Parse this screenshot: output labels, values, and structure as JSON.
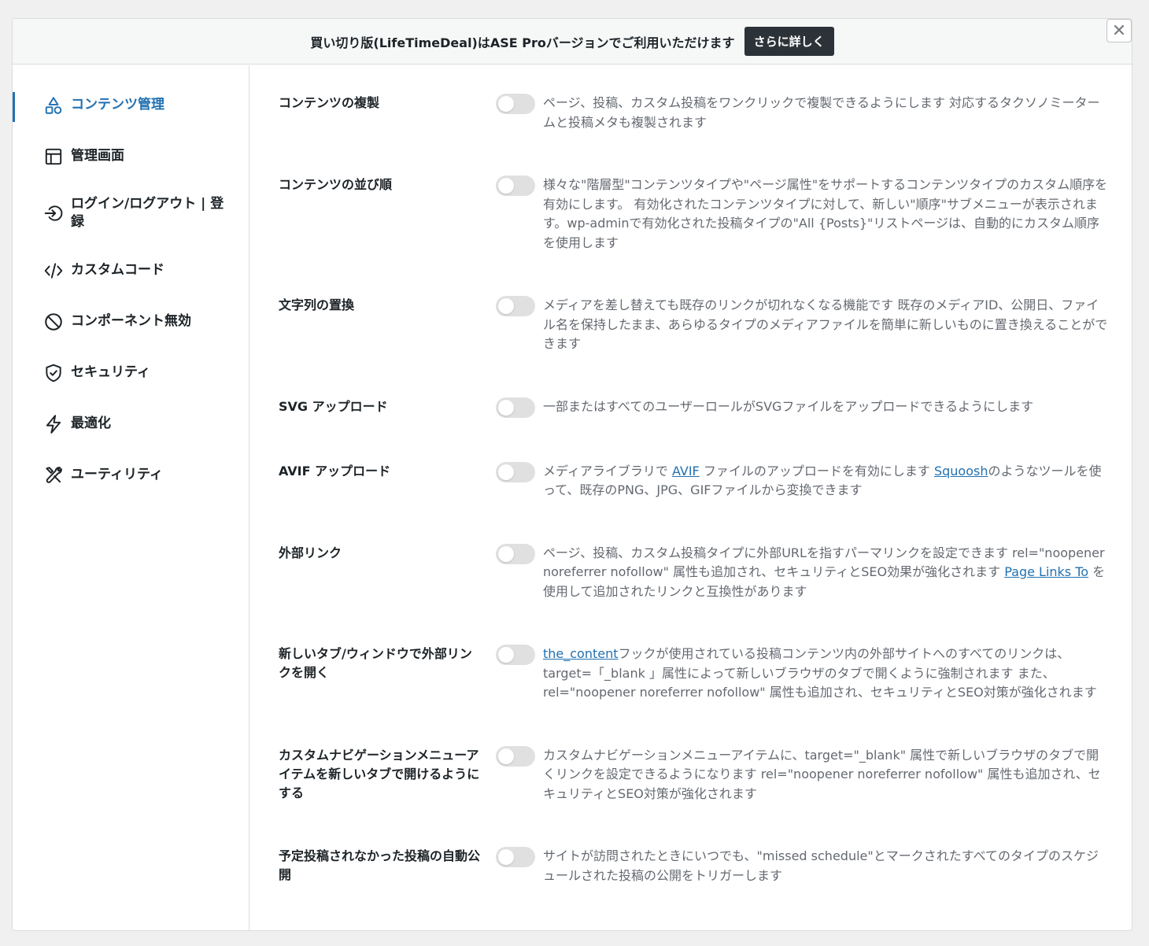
{
  "banner": {
    "text": "買い切り版(LifeTimeDeal)はASE Proバージョンでご利用いただけます",
    "button_label": "さらに詳しく"
  },
  "close_symbol": "✕",
  "colors": {
    "accent": "#2271b1",
    "banner_button": "#2c3338",
    "toggle_off": "#e0e0e0"
  },
  "sidebar": {
    "items": [
      {
        "label": "コンテンツ管理",
        "icon": "shapes-icon",
        "active": true
      },
      {
        "label": "管理画面",
        "icon": "layout-icon"
      },
      {
        "label": "ログイン/ログアウト | 登録",
        "icon": "login-icon"
      },
      {
        "label": "カスタムコード",
        "icon": "code-icon"
      },
      {
        "label": "コンポーネント無効",
        "icon": "ban-icon"
      },
      {
        "label": "セキュリティ",
        "icon": "shield-check-icon"
      },
      {
        "label": "最適化",
        "icon": "lightning-icon"
      },
      {
        "label": "ユーティリティ",
        "icon": "tools-icon"
      }
    ]
  },
  "settings": [
    {
      "title": "コンテンツの複製",
      "enabled": false,
      "desc": [
        "ページ、投稿、カスタム投稿をワンクリックで複製できるようにします 対応するタクソノミータームと投稿メタも複製されます"
      ]
    },
    {
      "title": "コンテンツの並び順",
      "enabled": false,
      "desc": [
        "様々な\"階層型\"コンテンツタイプや\"ページ属性\"をサポートするコンテンツタイプのカスタム順序を有効にします。 有効化されたコンテンツタイプに対して、新しい\"順序\"サブメニューが表示されます。wp-adminで有効化された投稿タイプの\"All {Posts}\"リストページは、自動的にカスタム順序を使用します"
      ]
    },
    {
      "title": "文字列の置換",
      "enabled": false,
      "desc": [
        "メディアを差し替えても既存のリンクが切れなくなる機能です 既存のメディアID、公開日、ファイル名を保持したまま、あらゆるタイプのメディアファイルを簡単に新しいものに置き換えることができます"
      ]
    },
    {
      "title": "SVG アップロード",
      "enabled": false,
      "desc": [
        "一部またはすべてのユーザーロールがSVGファイルをアップロードできるようにします"
      ]
    },
    {
      "title": "AVIF アップロード",
      "enabled": false,
      "desc": [
        "メディアライブラリで ",
        {
          "link": "AVIF"
        },
        " ファイルのアップロードを有効にします ",
        {
          "link": "Squoosh"
        },
        "のようなツールを使って、既存のPNG、JPG、GIFファイルから変換できます"
      ]
    },
    {
      "title": "外部リンク",
      "enabled": false,
      "desc": [
        "ページ、投稿、カスタム投稿タイプに外部URLを指すパーマリンクを設定できます rel=\"noopener noreferrer nofollow\" 属性も追加され、セキュリティとSEO効果が強化されます ",
        {
          "link": "Page Links To"
        },
        " を使用して追加されたリンクと互換性があります"
      ]
    },
    {
      "title": "新しいタブ/ウィンドウで外部リンクを開く",
      "enabled": false,
      "desc": [
        {
          "link": "the_content"
        },
        "フックが使用されている投稿コンテンツ内の外部サイトへのすべてのリンクは、target=「_blank 」属性によって新しいブラウザのタブで開くように強制されます また、 rel=\"noopener noreferrer nofollow\" 属性も追加され、セキュリティとSEO対策が強化されます"
      ]
    },
    {
      "title": "カスタムナビゲーションメニューアイテムを新しいタブで開けるようにする",
      "enabled": false,
      "desc": [
        "カスタムナビゲーションメニューアイテムに、target=\"_blank\" 属性で新しいブラウザのタブで開くリンクを設定できるようになります rel=\"noopener noreferrer nofollow\" 属性も追加され、セキュリティとSEO対策が強化されます"
      ]
    },
    {
      "title": "予定投稿されなかった投稿の自動公開",
      "enabled": false,
      "desc": [
        "サイトが訪問されたときにいつでも、\"missed schedule\"とマークされたすべてのタイプのスケジュールされた投稿の公開をトリガーします"
      ]
    }
  ]
}
